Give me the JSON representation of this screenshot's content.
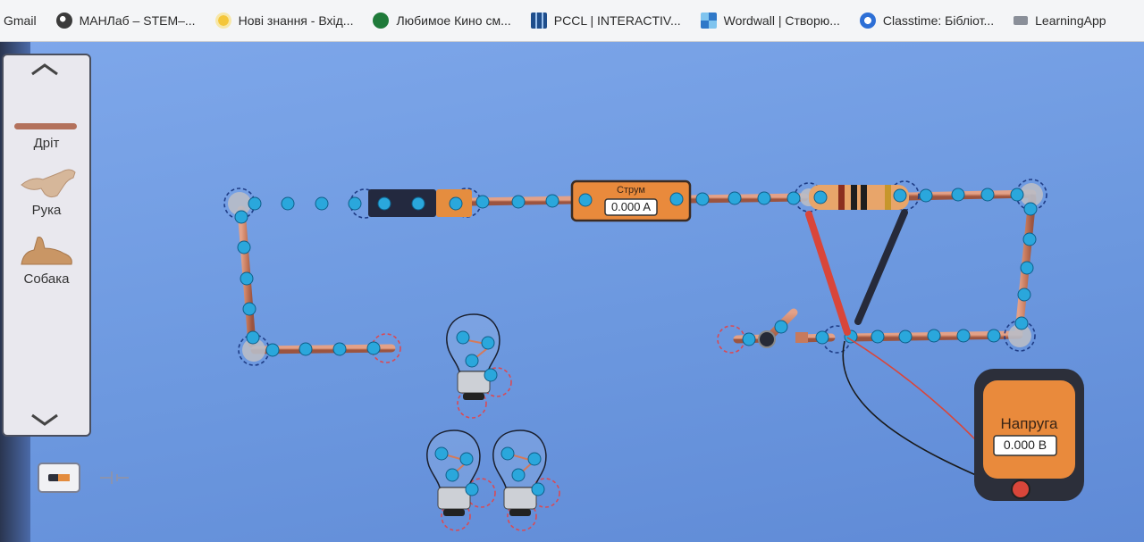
{
  "bookmarks": [
    {
      "label": "Gmail",
      "icon": "gmail-icon"
    },
    {
      "label": "МАНЛаб – STEM–...",
      "icon": "globe-icon"
    },
    {
      "label": "Нові знання - Вхід...",
      "icon": "sun-icon"
    },
    {
      "label": "Любимое Кино см...",
      "icon": "film-icon"
    },
    {
      "label": "PCCL | INTERACTIV...",
      "icon": "grid-icon"
    },
    {
      "label": "Wordwall | Створю...",
      "icon": "wordwall-icon"
    },
    {
      "label": "Classtime: Бібліот...",
      "icon": "classtime-icon"
    },
    {
      "label": "LearningApp",
      "icon": "learningapps-icon"
    }
  ],
  "toolbox": {
    "items": [
      {
        "label": "Дріт",
        "icon": "wire-icon"
      },
      {
        "label": "Рука",
        "icon": "hand-cat-icon"
      },
      {
        "label": "Собака",
        "icon": "dog-icon"
      }
    ],
    "scroll_up_icon": "chevron-up-icon",
    "scroll_down_icon": "chevron-down-icon"
  },
  "view_toggle": {
    "lifelike_icon": "lifelike-resistor-icon",
    "schematic_icon": "schematic-icon"
  },
  "ammeter": {
    "title": "Струм",
    "value": "0.000 A"
  },
  "voltmeter": {
    "title": "Напруга",
    "value": "0.000 B"
  },
  "colors": {
    "background": "#6f9be0",
    "wire": "#c77a5c",
    "electron": "#2aa7dc",
    "meter_orange": "#e98a3c",
    "meter_body": "#2c2f3a",
    "red_probe": "#d9463a",
    "black_probe": "#262a3a"
  }
}
